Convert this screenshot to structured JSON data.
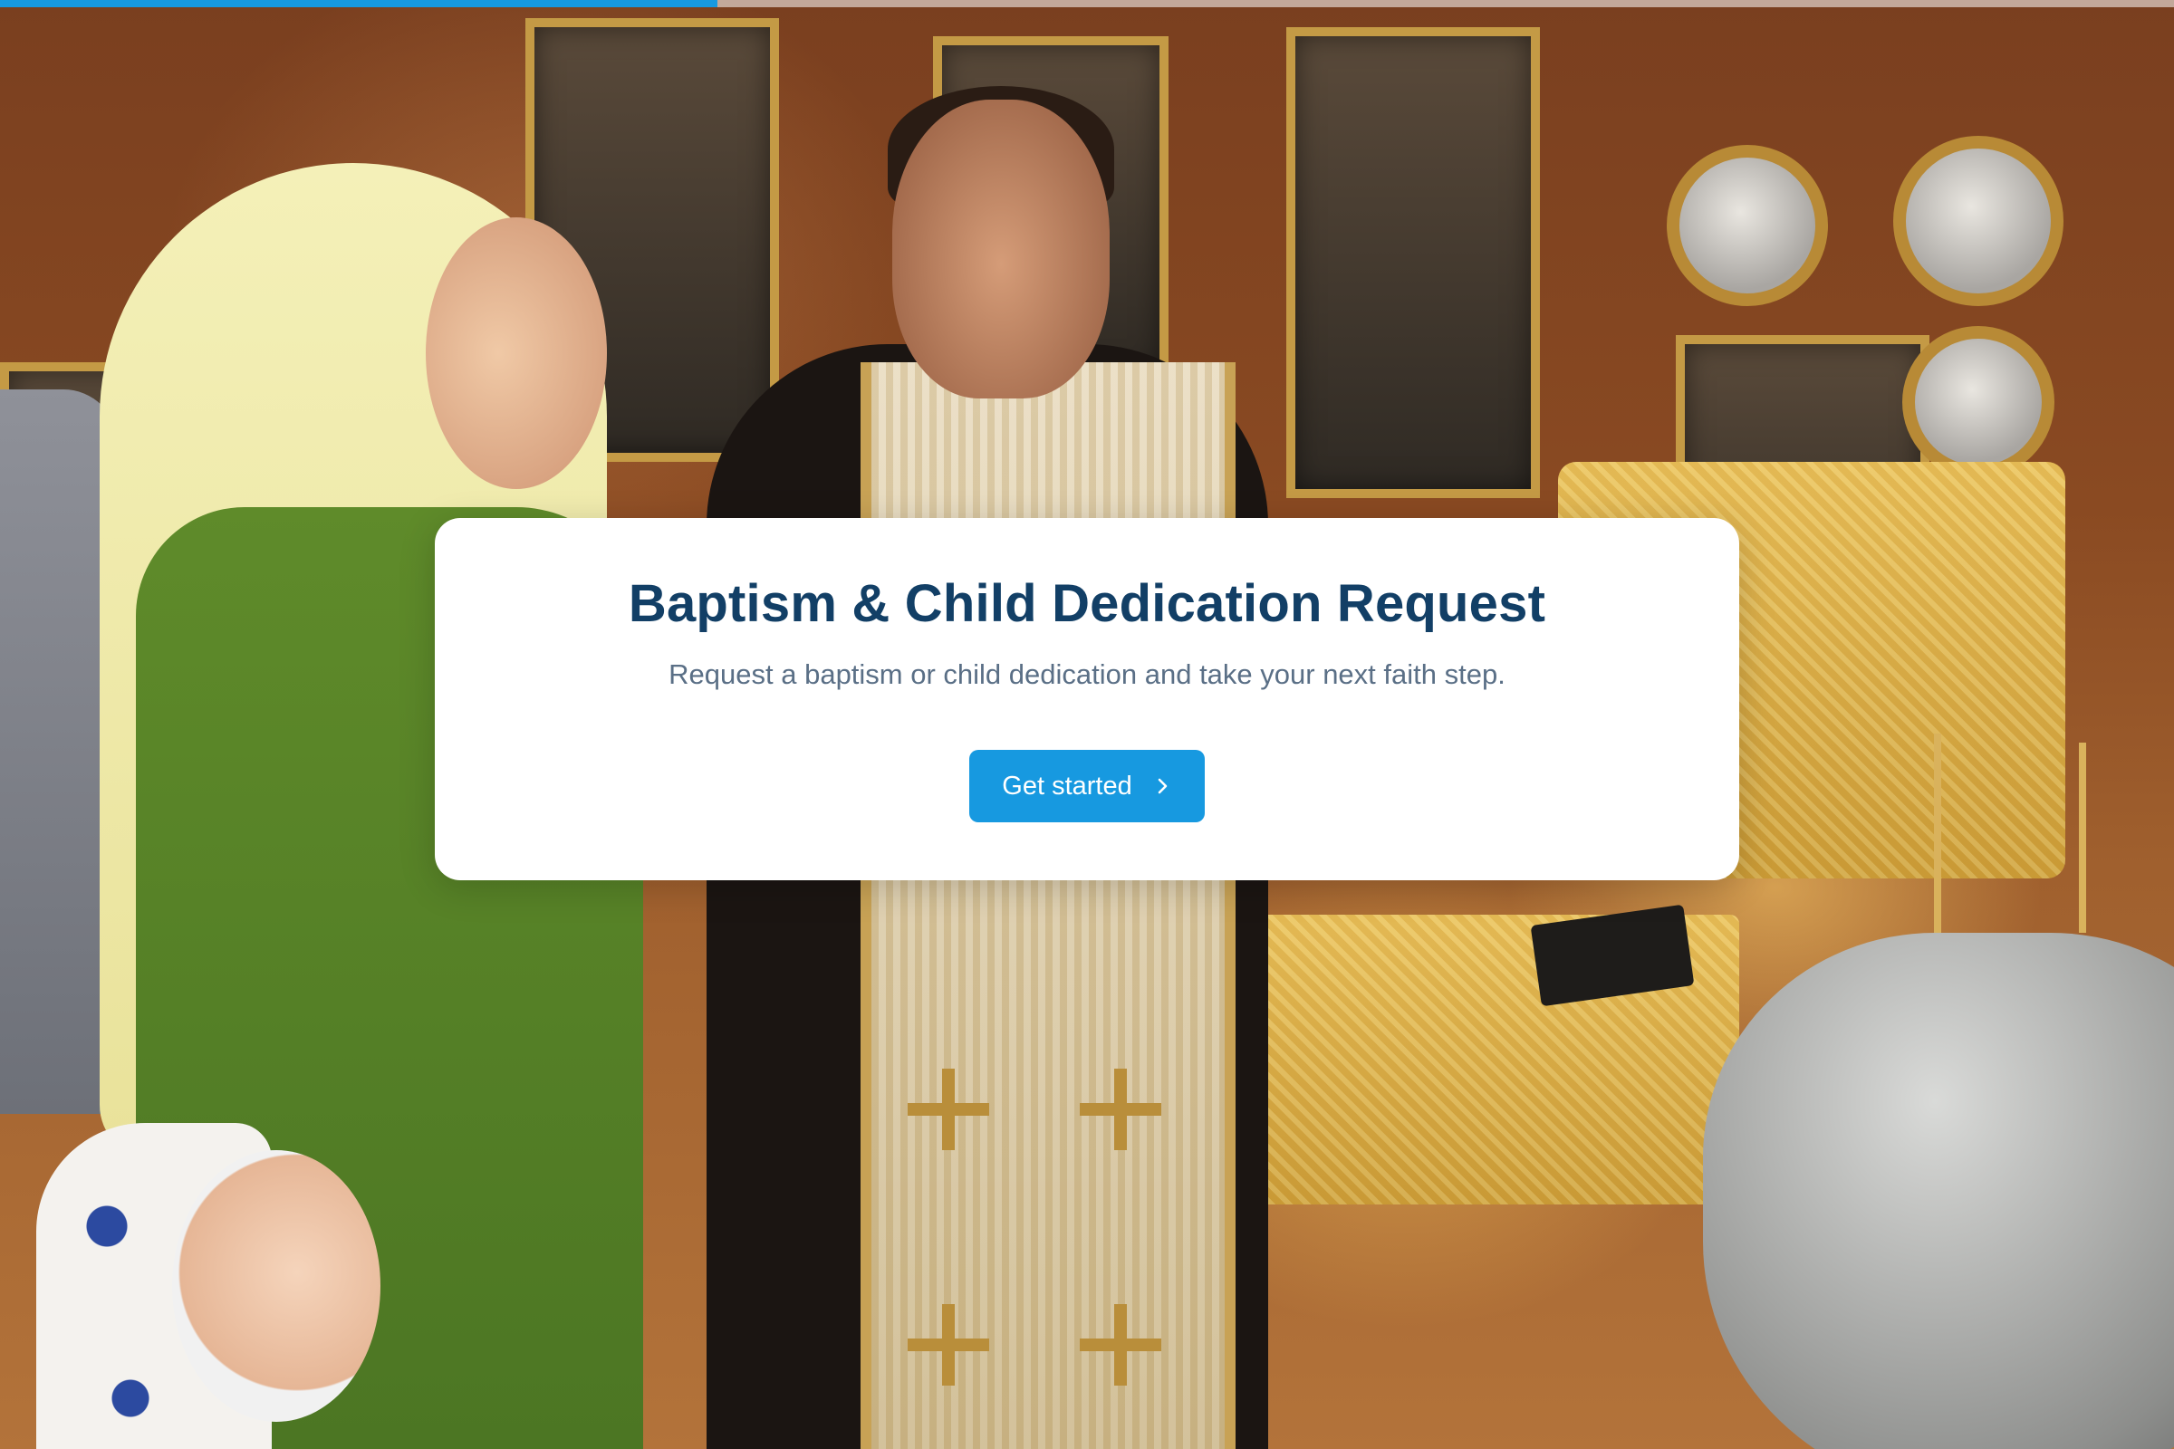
{
  "progress": {
    "value_percent": 33,
    "color": "#1799e0"
  },
  "card": {
    "title": "Baptism & Child Dedication Request",
    "subtitle": "Request a baptism or child dedication and take your next faith step.",
    "button_label": "Get started",
    "button_icon": "chevron-right-icon",
    "title_color": "#123f66",
    "accent_color": "#1799e0"
  }
}
